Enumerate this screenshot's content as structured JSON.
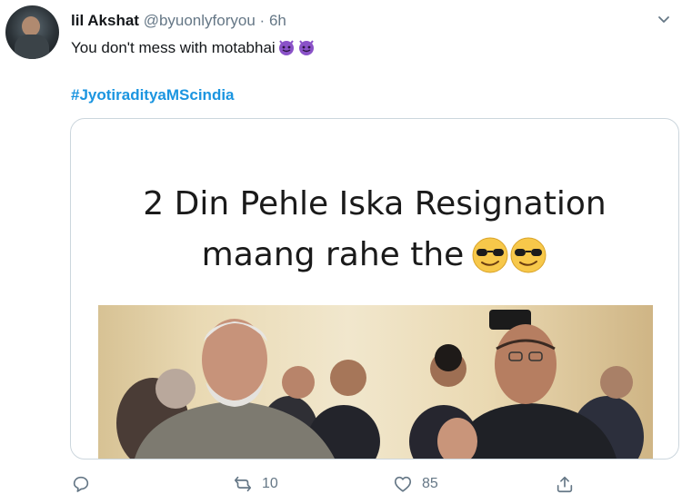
{
  "tweet": {
    "display_name": "lil Akshat",
    "handle": "@byuonlyforyou",
    "separator": "·",
    "time": "6h",
    "text": "You don't mess with motabhai",
    "hashtag": "#JyotiradityaMScindia"
  },
  "media": {
    "caption_line1": "2 Din Pehle Iska Resignation",
    "caption_line2": "maang rahe the"
  },
  "actions": {
    "reply_count": "",
    "retweet_count": "10",
    "like_count": "85"
  },
  "colors": {
    "link": "#1b95e0",
    "secondary_text": "#657786",
    "devil_emoji": "#8a52c8",
    "border": "#ccd6dd"
  },
  "icons": [
    "avatar",
    "chevron-down-icon",
    "devil-emoji-icon",
    "sunglasses-emoji-icon",
    "reply-icon",
    "retweet-icon",
    "like-icon",
    "share-icon"
  ]
}
